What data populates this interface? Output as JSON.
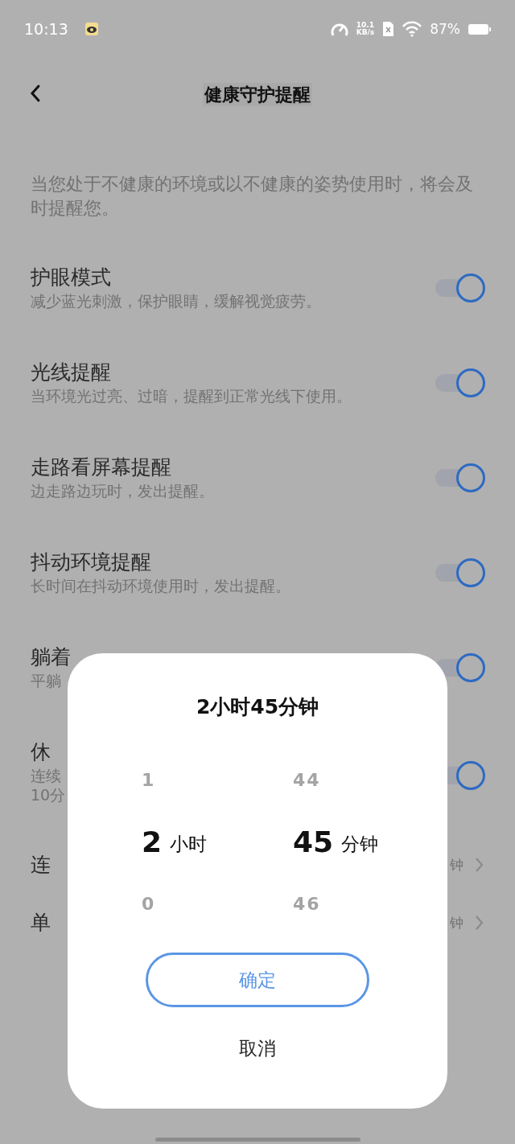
{
  "status_bar": {
    "time": "10:13",
    "net_speed": "10.1",
    "net_unit": "KB/s",
    "battery": "87%"
  },
  "header": {
    "title": "健康守护提醒"
  },
  "description": "当您处于不健康的环境或以不健康的姿势使用时，将会及时提醒您。",
  "settings": [
    {
      "kind": "toggle",
      "title": "护眼模式",
      "subtitle": "减少蓝光刺激，保护眼睛，缓解视觉疲劳。",
      "on": true
    },
    {
      "kind": "toggle",
      "title": "光线提醒",
      "subtitle": "当环境光过亮、过暗，提醒到正常光线下使用。",
      "on": true
    },
    {
      "kind": "toggle",
      "title": "走路看屏幕提醒",
      "subtitle": "边走路边玩时，发出提醒。",
      "on": true
    },
    {
      "kind": "toggle",
      "title": "抖动环境提醒",
      "subtitle": "长时间在抖动环境使用时，发出提醒。",
      "on": true
    },
    {
      "kind": "toggle",
      "title": "躺着",
      "subtitle": "平躺",
      "on": true
    },
    {
      "kind": "toggle",
      "title": "休",
      "subtitle": "连续",
      "subtitle_2": "10分",
      "on": true
    },
    {
      "kind": "value",
      "title": "连",
      "value": "钟"
    },
    {
      "kind": "value",
      "title": "单",
      "value": "钟"
    }
  ],
  "dialog": {
    "title": "2小时45分钟",
    "columns": [
      {
        "unit": "小时",
        "items": [
          {
            "value": "1",
            "selected": false
          },
          {
            "value": "2",
            "selected": true
          },
          {
            "value": "0",
            "selected": false
          }
        ]
      },
      {
        "unit": "分钟",
        "items": [
          {
            "value": "44",
            "selected": false
          },
          {
            "value": "45",
            "selected": true
          },
          {
            "value": "46",
            "selected": false
          }
        ]
      }
    ],
    "confirm": "确定",
    "cancel": "取消"
  }
}
